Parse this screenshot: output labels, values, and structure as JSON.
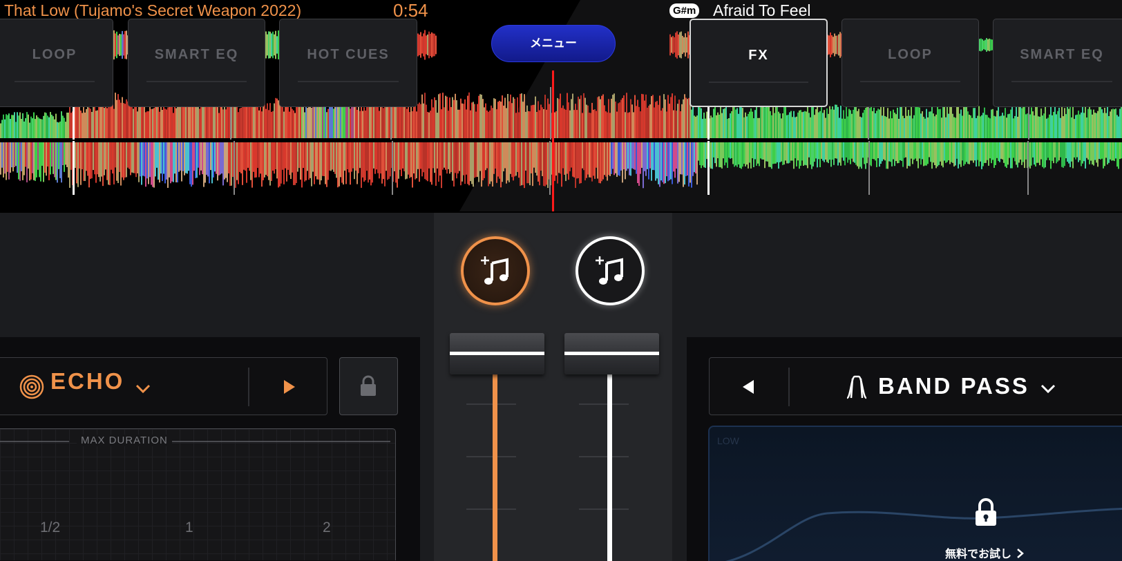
{
  "left_deck": {
    "title": "That Low (Tujamo's Secret Weapon 2022)",
    "time": "0:54",
    "accent_color": "#f0924a",
    "tabs": [
      "LOOP",
      "SMART EQ",
      "HOT CUES"
    ],
    "fx": {
      "name": "ECHO",
      "icon": "echo-icon",
      "play_icon": "play-icon",
      "lock_icon": "lock-icon",
      "grid_title": "MAX DURATION",
      "durations": [
        "1/2",
        "1",
        "2"
      ]
    }
  },
  "right_deck": {
    "key": "G#m",
    "title": "Afraid To Feel",
    "accent_color": "#ffffff",
    "tabs": [
      "FX",
      "LOOP",
      "SMART EQ"
    ],
    "active_tab": "FX",
    "fx": {
      "name": "BAND PASS",
      "icon": "band-pass-icon",
      "prev_icon": "play-left-icon",
      "area_label": "LOW",
      "unlock_label": "無料でお試し"
    }
  },
  "menu": {
    "label": "メニュー",
    "color": "#1c28b8"
  },
  "mixer": {
    "left_add_icon": "add-music-icon",
    "right_add_icon": "add-music-icon"
  }
}
